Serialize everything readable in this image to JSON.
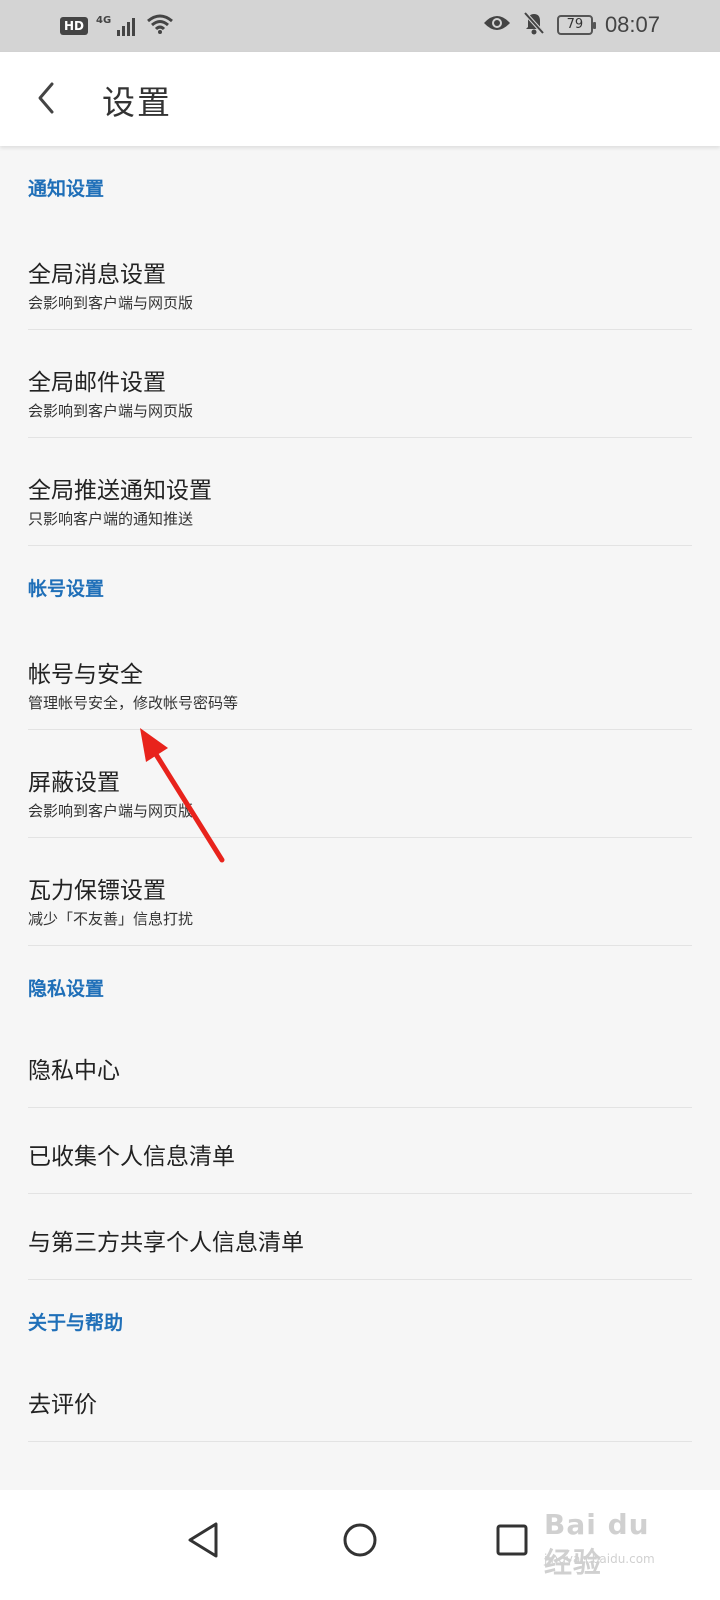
{
  "status_bar": {
    "hd_label": "HD",
    "network_label": "4G",
    "battery_level": "79",
    "time": "08:07",
    "icons": [
      "hd-icon",
      "signal-icon",
      "wifi-icon",
      "eye-icon",
      "bell-muted-icon",
      "battery-icon"
    ]
  },
  "app_bar": {
    "title": "设置",
    "back_icon": "chevron-left-icon"
  },
  "sections": [
    {
      "header": "通知设置",
      "items": [
        {
          "title": "全局消息设置",
          "subtitle": "会影响到客户端与网页版"
        },
        {
          "title": "全局邮件设置",
          "subtitle": "会影响到客户端与网页版"
        },
        {
          "title": "全局推送通知设置",
          "subtitle": "只影响客户端的通知推送"
        }
      ]
    },
    {
      "header": "帐号设置",
      "items": [
        {
          "title": "帐号与安全",
          "subtitle": "管理帐号安全，修改帐号密码等"
        },
        {
          "title": "屏蔽设置",
          "subtitle": "会影响到客户端与网页版"
        },
        {
          "title": "瓦力保镖设置",
          "subtitle": "减少「不友善」信息打扰"
        }
      ]
    },
    {
      "header": "隐私设置",
      "items": [
        {
          "title": "隐私中心"
        },
        {
          "title": "已收集个人信息清单"
        },
        {
          "title": "与第三方共享个人信息清单"
        }
      ]
    },
    {
      "header": "关于与帮助",
      "items": [
        {
          "title": "去评价"
        }
      ]
    }
  ],
  "annotation": {
    "type": "red-arrow",
    "color": "#e8231c",
    "points_to": "帐号与安全"
  },
  "nav_bar": {
    "icons": [
      "back-triangle-icon",
      "home-circle-icon",
      "recents-square-icon"
    ]
  },
  "watermark": {
    "main": "Bai du 经验",
    "sub": "jingyan.baidu.com"
  },
  "colors": {
    "accent": "#1f6fb8",
    "status_bar_bg": "#d4d4d4",
    "page_bg": "#f6f6f6"
  }
}
